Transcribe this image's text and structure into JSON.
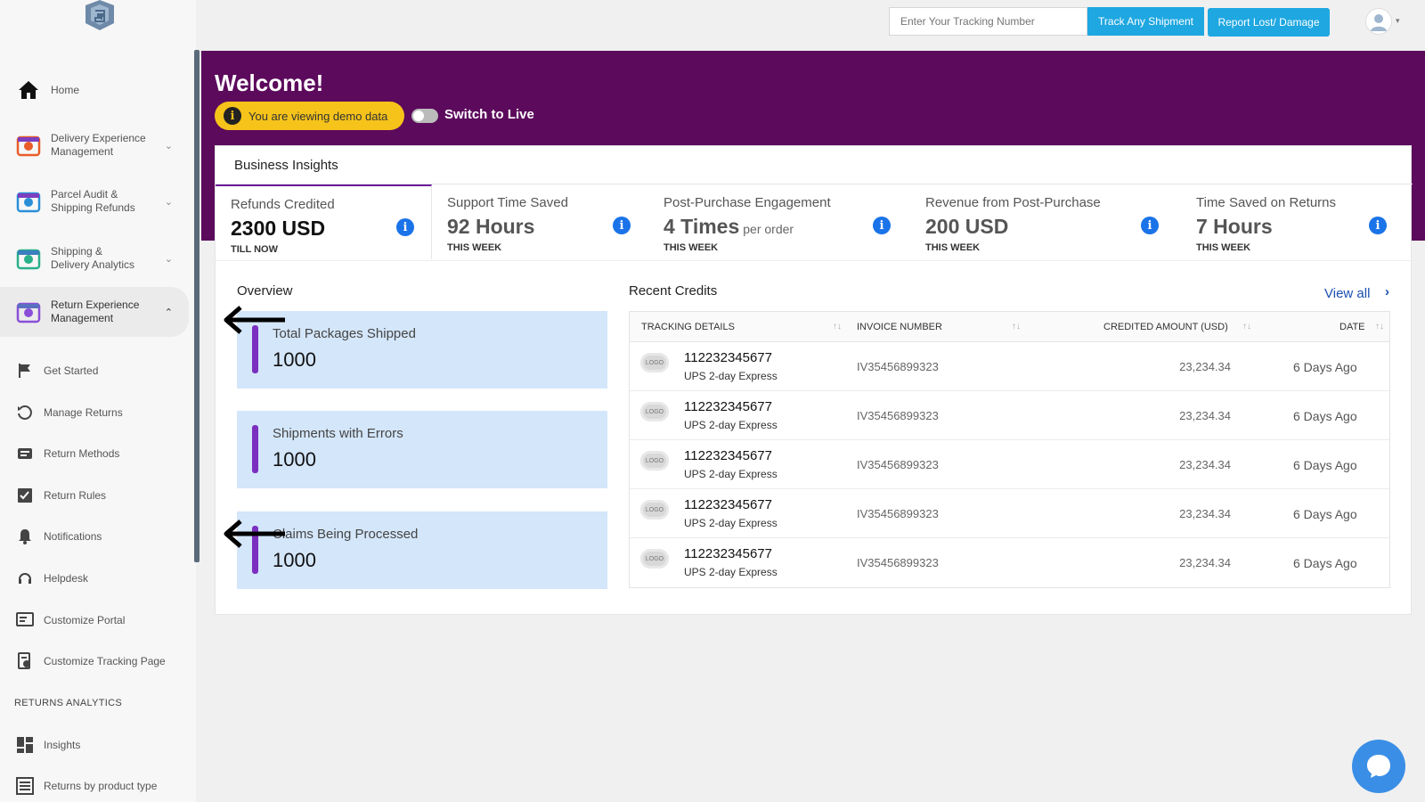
{
  "topbar": {
    "tracking_placeholder": "Enter Your Tracking Number",
    "track_button": "Track Any Shipment",
    "report_button": "Report Lost/ Damage"
  },
  "sidebar": {
    "items": [
      {
        "label": "Home",
        "icon": "home-icon"
      },
      {
        "label": "Delivery Experience Management",
        "icon": "delivery-experience-icon"
      },
      {
        "label": "Parcel Audit & Shipping Refunds",
        "icon": "parcel-audit-icon"
      },
      {
        "label": "Shipping & Delivery Analytics",
        "icon": "shipping-analytics-icon"
      },
      {
        "label": "Return Experience Management",
        "icon": "return-experience-icon"
      }
    ],
    "sub_items": [
      {
        "label": "Get Started",
        "icon": "flag-icon"
      },
      {
        "label": "Manage Returns",
        "icon": "undo-icon"
      },
      {
        "label": "Return Methods",
        "icon": "methods-icon"
      },
      {
        "label": "Return Rules",
        "icon": "rules-icon"
      },
      {
        "label": "Notifications",
        "icon": "bell-icon"
      },
      {
        "label": "Helpdesk",
        "icon": "headset-icon"
      },
      {
        "label": "Customize Portal",
        "icon": "portal-icon"
      },
      {
        "label": "Customize Tracking Page",
        "icon": "tracking-page-icon"
      }
    ],
    "section_label": "RETURNS ANALYTICS",
    "analytics_items": [
      {
        "label": "Insights",
        "icon": "grid-icon"
      },
      {
        "label": "Returns by product type",
        "icon": "list-icon"
      }
    ]
  },
  "hero": {
    "welcome": "Welcome!",
    "demo_notice": "You are viewing demo data",
    "switch_label": "Switch to Live"
  },
  "insights": {
    "title": "Business Insights",
    "kpis": [
      {
        "name": "Refunds Credited",
        "value": "2300 USD",
        "suffix": "",
        "period": "TILL NOW"
      },
      {
        "name": "Support Time Saved",
        "value": "92 Hours",
        "suffix": "",
        "period": "THIS WEEK"
      },
      {
        "name": "Post-Purchase Engagement",
        "value": "4 Times",
        "suffix": "per order",
        "period": "THIS WEEK"
      },
      {
        "name": "Revenue from Post-Purchase",
        "value": "200 USD",
        "suffix": "",
        "period": "THIS WEEK"
      },
      {
        "name": "Time Saved on Returns",
        "value": "7 Hours",
        "suffix": "",
        "period": "THIS WEEK"
      }
    ]
  },
  "overview": {
    "title": "Overview",
    "stats": [
      {
        "label": "Total Packages Shipped",
        "value": "1000"
      },
      {
        "label": "Shipments with Errors",
        "value": "1000"
      },
      {
        "label": "Claims Being Processed",
        "value": "1000"
      }
    ]
  },
  "recent_credits": {
    "title": "Recent Credits",
    "view_all": "View all",
    "headers": [
      "TRACKING DETAILS",
      "INVOICE NUMBER",
      "CREDITED AMOUNT (USD)",
      "DATE"
    ],
    "logo_text": "LOGO",
    "rows": [
      {
        "tracking": "112232345677",
        "carrier": "UPS 2-day Express",
        "invoice": "IV35456899323",
        "amount": "23,234.34",
        "date": "6 Days Ago"
      },
      {
        "tracking": "112232345677",
        "carrier": "UPS 2-day Express",
        "invoice": "IV35456899323",
        "amount": "23,234.34",
        "date": "6 Days Ago"
      },
      {
        "tracking": "112232345677",
        "carrier": "UPS 2-day Express",
        "invoice": "IV35456899323",
        "amount": "23,234.34",
        "date": "6 Days Ago"
      },
      {
        "tracking": "112232345677",
        "carrier": "UPS 2-day Express",
        "invoice": "IV35456899323",
        "amount": "23,234.34",
        "date": "6 Days Ago"
      },
      {
        "tracking": "112232345677",
        "carrier": "UPS 2-day Express",
        "invoice": "IV35456899323",
        "amount": "23,234.34",
        "date": "6 Days Ago"
      }
    ]
  },
  "colors": {
    "hero_bg": "#5c0a5c",
    "accent_blue": "#1ea7e1",
    "demo_yellow": "#f6c31a",
    "stat_box_bg": "#d4e6fa",
    "stat_bar": "#7b2fbf"
  }
}
